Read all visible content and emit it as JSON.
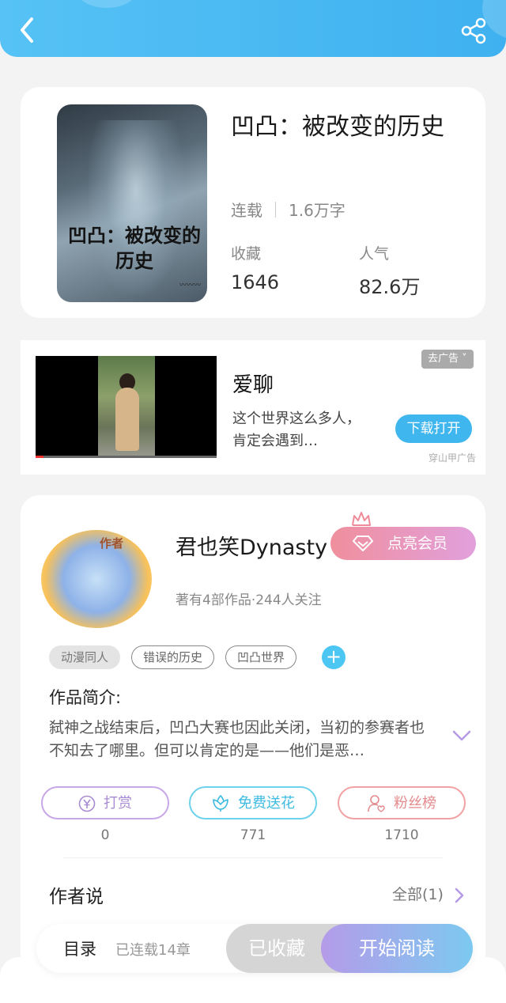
{
  "header": {
    "back_icon": "chevron-left-icon",
    "share_icon": "share-icon",
    "color": "#4ab9f3"
  },
  "book": {
    "title": "凹凸：被改变的历史",
    "cover_title": "凹凸：被改变的历史",
    "status": "连载",
    "word_count": "1.6万字",
    "stats": [
      {
        "label": "收藏",
        "value": "1646"
      },
      {
        "label": "人气",
        "value": "82.6万"
      }
    ]
  },
  "ad": {
    "name": "爱聊",
    "description": "这个世界这么多人，肯定会遇到…",
    "remove_label": "去广告 ˅",
    "download_label": "下载打开",
    "source": "穿山甲广告"
  },
  "author": {
    "avatar_badge": "作者",
    "name": "君也笑Dynasty",
    "vip_label": "点亮会员",
    "info": "著有4部作品·244人关注",
    "tags": [
      "动漫同人",
      "错误的历史",
      "凹凸世界"
    ],
    "intro_title": "作品简介:",
    "intro_text": "弑神之战结束后，凹凸大赛也因此关闭，当初的参赛者也不知去了哪里。但可以肯定的是——他们是恶…",
    "actions": [
      {
        "label": "打赏",
        "count": "0",
        "icon": "yen-icon"
      },
      {
        "label": "免费送花",
        "count": "771",
        "icon": "flower-icon"
      },
      {
        "label": "粉丝榜",
        "count": "1710",
        "icon": "fan-user-icon"
      }
    ],
    "author_says": "作者说",
    "all_link": "全部(1)"
  },
  "bottom_bar": {
    "toc_label": "目录",
    "toc_count": "已连载14章",
    "collected_label": "已收藏",
    "read_label": "开始阅读"
  }
}
